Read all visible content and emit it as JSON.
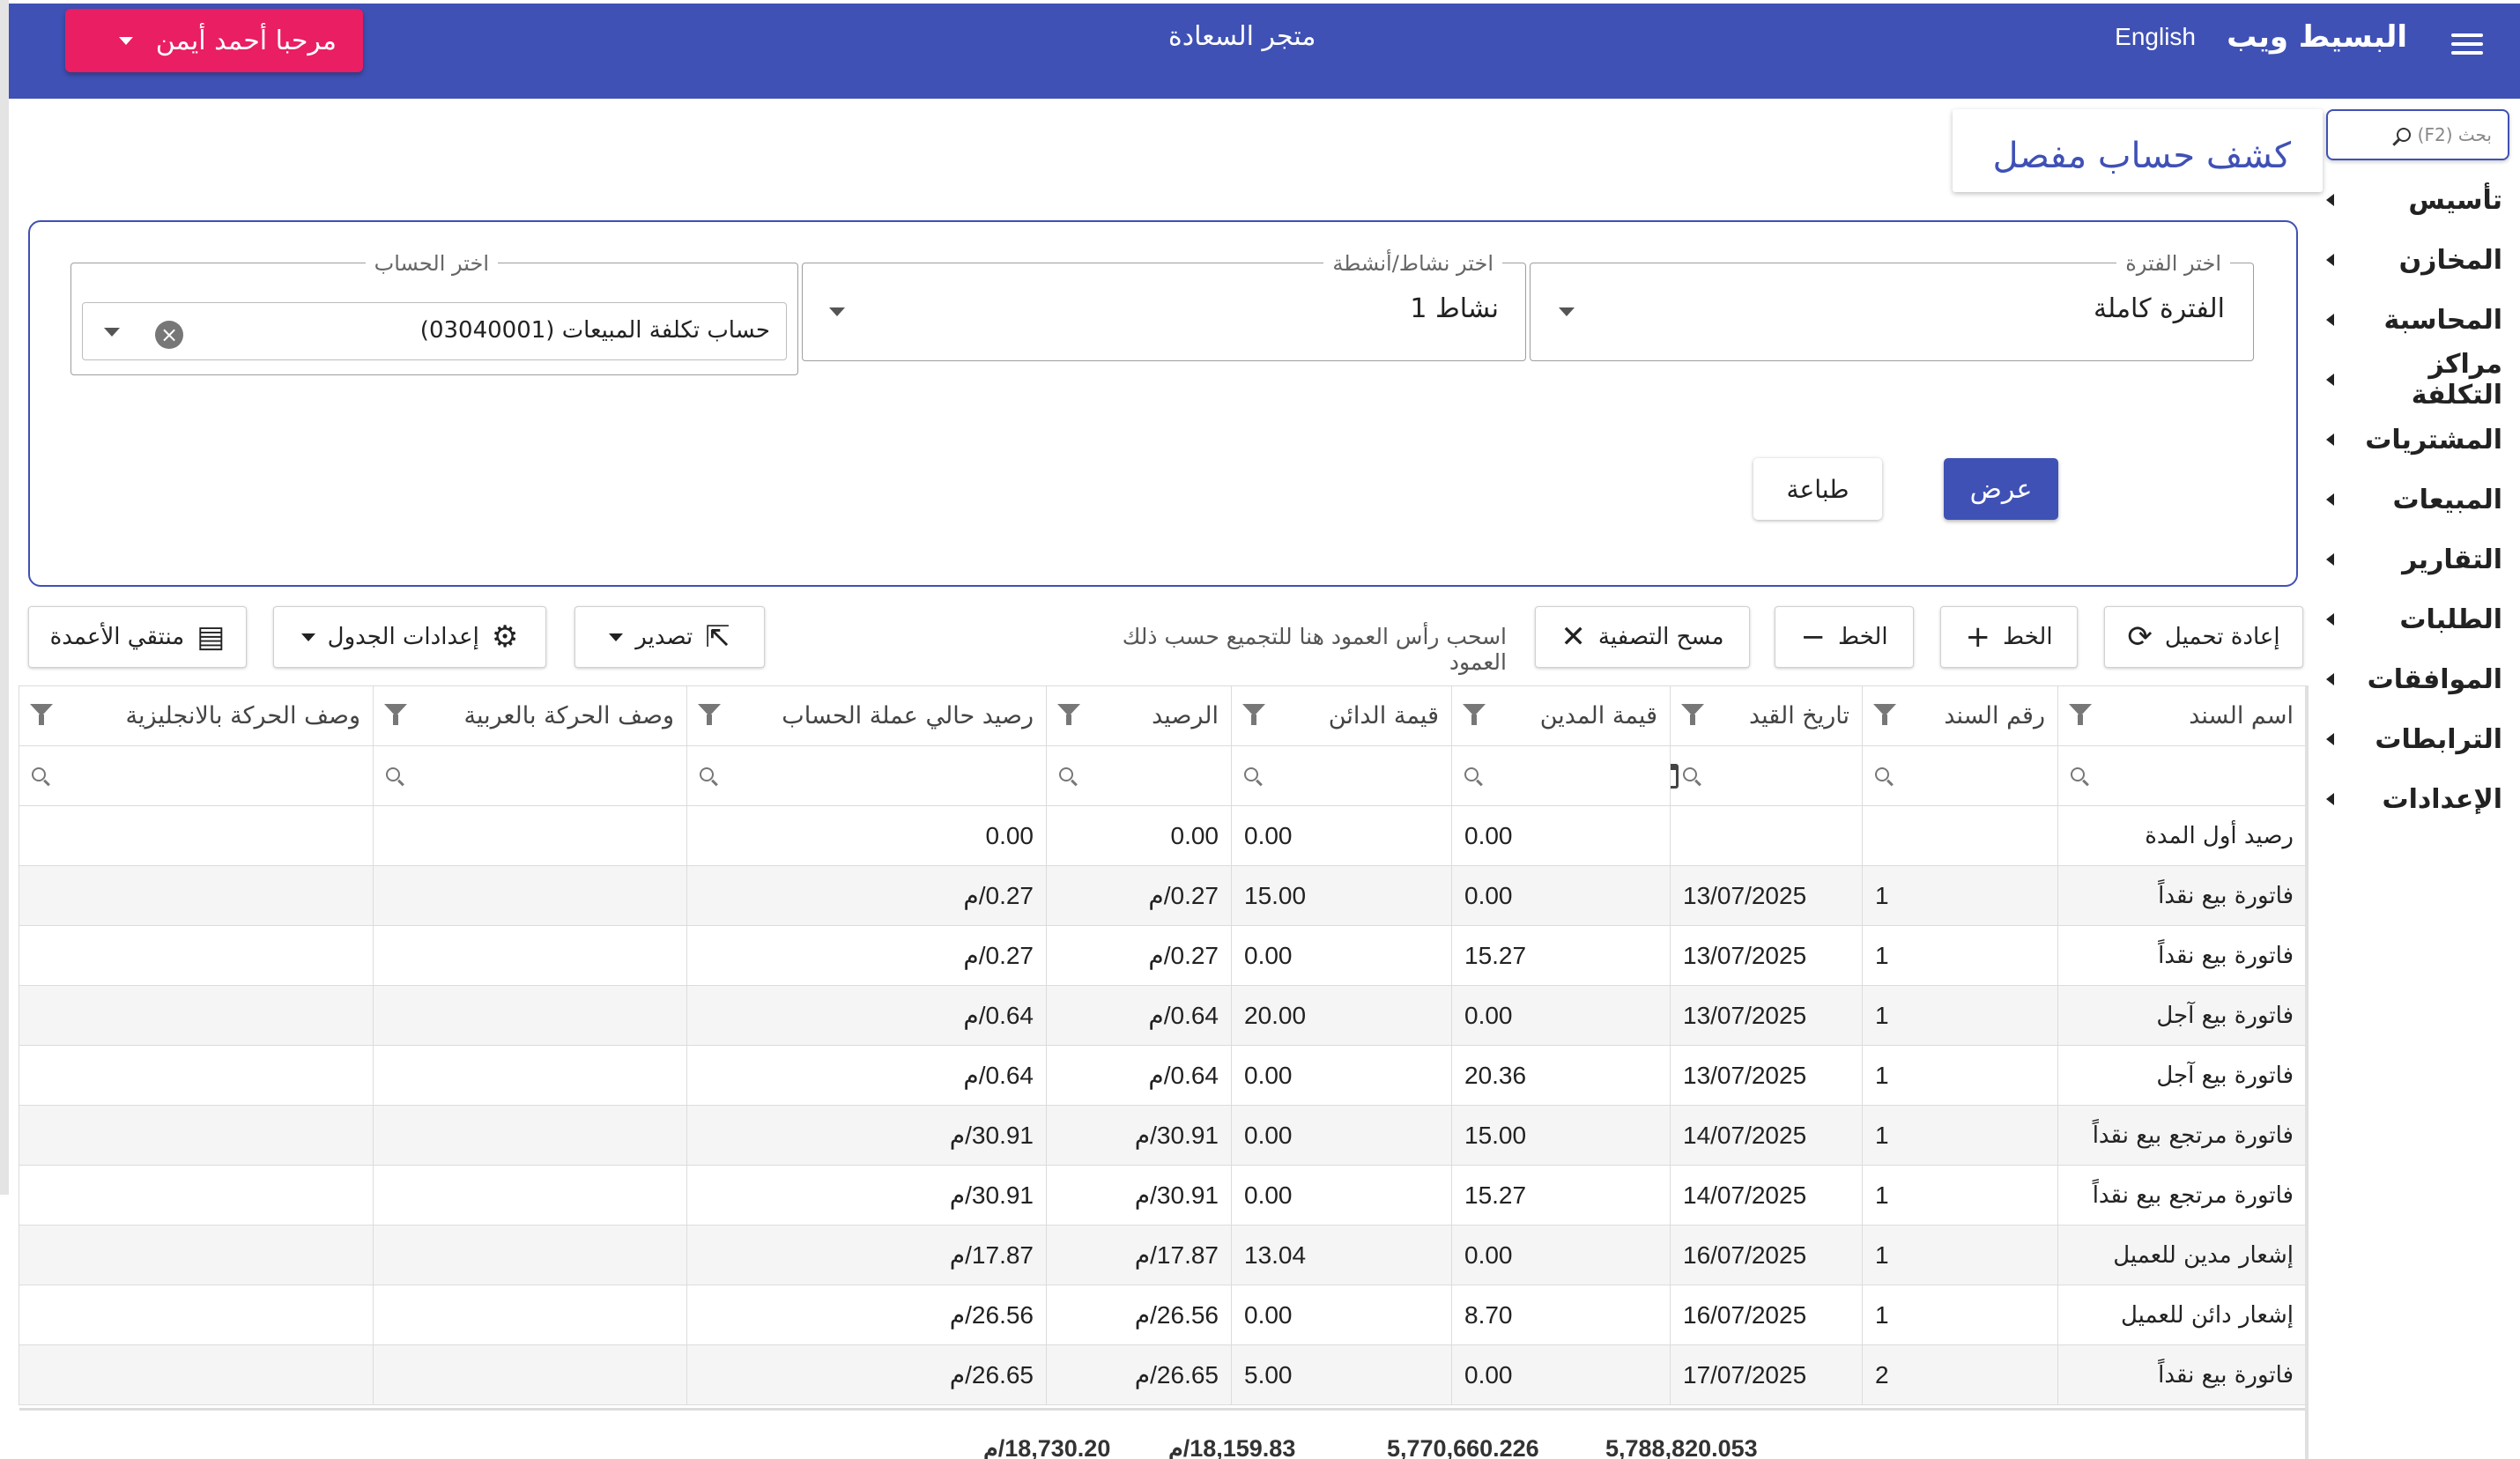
{
  "header": {
    "brand": "البسيط ويب",
    "language": "English",
    "store": "متجر السعادة",
    "user_greeting": "مرحبا أحمد أيمن"
  },
  "sidebar": {
    "search_placeholder": "بحث (F2)",
    "items": [
      "تأسيس",
      "المخازن",
      "المحاسبة",
      "مراكز التكلفة",
      "المشتريات",
      "المبيعات",
      "التقارير",
      "الطلبات",
      "الموافقات",
      "الترابطات",
      "الإعدادات"
    ]
  },
  "page": {
    "title": "كشف حساب مفصل"
  },
  "filters": {
    "period_label": "اختر الفترة",
    "period_value": "الفترة كاملة",
    "activity_label": "اختر نشاط/أنشطة",
    "activity_value": "نشاط 1",
    "account_label": "اختر الحساب",
    "account_value": "حساب تكلفة المبيعات (03040001)",
    "show_button": "عرض",
    "print_button": "طباعة"
  },
  "toolbar": {
    "reload": "إعادة تحميل",
    "add_line": "الخط",
    "remove_line": "الخط",
    "clear_filter": "مسح التصفية",
    "group_hint": "اسحب رأس العمود هنا للتجميع حسب ذلك العمود",
    "export": "تصدير",
    "table_settings": "إعدادات الجدول",
    "column_chooser": "منتقي الأعمدة"
  },
  "grid": {
    "columns": [
      "اسم السند",
      "رقم السند",
      "تاريخ القيد",
      "قيمة المدين",
      "قيمة الدائن",
      "الرصيد",
      "رصيد حالي عملة الحساب",
      "وصف الحركة بالعربية",
      "وصف الحركة بالانجليزية"
    ],
    "rows": [
      [
        "رصيد أول المدة",
        "",
        "",
        "0.00",
        "0.00",
        "0.00",
        "0.00",
        "",
        ""
      ],
      [
        "فاتورة بيع نقداً",
        "1",
        "13/07/2025",
        "0.00",
        "15.00",
        "0.27/م",
        "0.27/م",
        "",
        ""
      ],
      [
        "فاتورة بيع نقداً",
        "1",
        "13/07/2025",
        "15.27",
        "0.00",
        "0.27/م",
        "0.27/م",
        "",
        ""
      ],
      [
        "فاتورة بيع آجل",
        "1",
        "13/07/2025",
        "0.00",
        "20.00",
        "0.64/م",
        "0.64/م",
        "",
        ""
      ],
      [
        "فاتورة بيع آجل",
        "1",
        "13/07/2025",
        "20.36",
        "0.00",
        "0.64/م",
        "0.64/م",
        "",
        ""
      ],
      [
        "فاتورة مرتجع بيع نقداً",
        "1",
        "14/07/2025",
        "15.00",
        "0.00",
        "30.91/م",
        "30.91/م",
        "",
        ""
      ],
      [
        "فاتورة مرتجع بيع نقداً",
        "1",
        "14/07/2025",
        "15.27",
        "0.00",
        "30.91/م",
        "30.91/م",
        "",
        ""
      ],
      [
        "إشعار مدين للعميل",
        "1",
        "16/07/2025",
        "0.00",
        "13.04",
        "17.87/م",
        "17.87/م",
        "",
        ""
      ],
      [
        "إشعار دائن للعميل",
        "1",
        "16/07/2025",
        "8.70",
        "0.00",
        "26.56/م",
        "26.56/م",
        "",
        ""
      ],
      [
        "فاتورة بيع نقداً",
        "2",
        "17/07/2025",
        "0.00",
        "5.00",
        "26.65/م",
        "26.65/م",
        "",
        ""
      ]
    ],
    "totals": {
      "debit": "5,788,820.053",
      "credit": "5,770,660.226",
      "balance": "18,159.83/م",
      "current_balance": "18,730.20/م"
    }
  },
  "colors": {
    "primary": "#3f51b5",
    "accent": "#e91e63"
  },
  "icons": {
    "menu": "hamburger-icon",
    "search": "search-icon",
    "reload": "refresh-icon",
    "add": "plus-icon",
    "remove": "minus-icon",
    "clear": "close-icon",
    "export": "export-icon",
    "settings": "gear-icon",
    "columns": "column-chooser-icon",
    "filter": "filter-icon",
    "calendar": "calendar-icon"
  }
}
